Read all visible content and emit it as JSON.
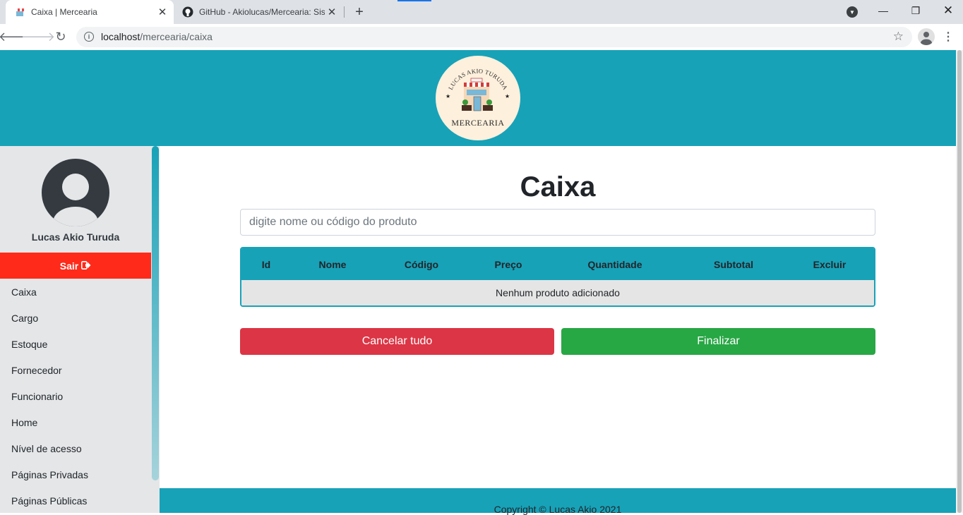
{
  "browser": {
    "tabs": [
      {
        "title": "Caixa | Mercearia",
        "active": true
      },
      {
        "title": "GitHub - Akiolucas/Mercearia: Sis",
        "active": false
      }
    ],
    "url_host": "localhost",
    "url_path": "/mercearia/caixa"
  },
  "header": {
    "logo_arc_text": "LUCAS AKIO TURUDA",
    "logo_word": "MERCEARIA"
  },
  "sidebar": {
    "user_name": "Lucas Akio Turuda",
    "logout_label": "Sair",
    "items": [
      {
        "label": "Caixa"
      },
      {
        "label": "Cargo"
      },
      {
        "label": "Estoque"
      },
      {
        "label": "Fornecedor"
      },
      {
        "label": "Funcionario"
      },
      {
        "label": "Home"
      },
      {
        "label": "Nível de acesso"
      },
      {
        "label": "Páginas Privadas"
      },
      {
        "label": "Páginas Públicas"
      }
    ]
  },
  "main": {
    "title": "Caixa",
    "search_placeholder": "digite nome ou código do produto",
    "table": {
      "headers": [
        "Id",
        "Nome",
        "Código",
        "Preço",
        "Quantidade",
        "Subtotal",
        "Excluir"
      ],
      "empty_message": "Nenhum produto adicionado"
    },
    "cancel_label": "Cancelar tudo",
    "finish_label": "Finalizar"
  },
  "footer": {
    "copyright": "Copyright © Lucas Akio 2021"
  },
  "colors": {
    "primary": "#17a2b8",
    "danger": "#dc3545",
    "success": "#28a745",
    "logout": "#ff2a1a"
  }
}
